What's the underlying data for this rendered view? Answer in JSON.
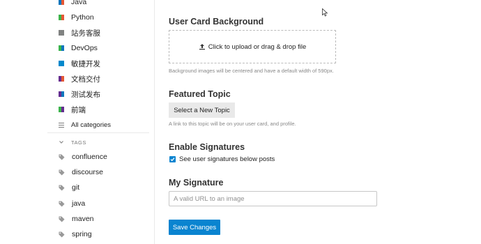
{
  "sidebar": {
    "categories": [
      {
        "label": "Java",
        "colors": [
          "#0e76bd",
          "#e45735"
        ]
      },
      {
        "label": "Python",
        "colors": [
          "#3ab54a",
          "#e45735"
        ]
      },
      {
        "label": "站务客服",
        "colors": [
          "#808281",
          "#808281"
        ]
      },
      {
        "label": "DevOps",
        "colors": [
          "#3ab54a",
          "#0e76bd"
        ]
      },
      {
        "label": "敏捷开发",
        "colors": [
          "#0088cc",
          "#0088cc"
        ]
      },
      {
        "label": "文档交付",
        "colors": [
          "#652d90",
          "#e45735"
        ]
      },
      {
        "label": "测试发布",
        "colors": [
          "#652d90",
          "#0e76bd"
        ]
      },
      {
        "label": "前端",
        "colors": [
          "#3ab54a",
          "#652d90"
        ]
      }
    ],
    "all_categories": "All categories",
    "tags_header": "TAGS",
    "tags": [
      "confluence",
      "discourse",
      "git",
      "java",
      "maven",
      "spring"
    ]
  },
  "main": {
    "user_card": {
      "title": "User Card Background",
      "upload_label": "Click to upload or drag & drop file",
      "help": "Background images will be centered and have a default width of 590px."
    },
    "featured": {
      "title": "Featured Topic",
      "button": "Select a New Topic",
      "help": "A link to this topic will be on your user card, and profile."
    },
    "signatures": {
      "title": "Enable Signatures",
      "checkbox_label": "See user signatures below posts",
      "checked": true
    },
    "my_signature": {
      "title": "My Signature",
      "placeholder": "A valid URL to an image",
      "value": ""
    },
    "save_button": "Save Changes"
  },
  "colors": {
    "primary": "#0a84d0",
    "button_gray": "#e9e9e9",
    "muted_text": "#888888"
  }
}
